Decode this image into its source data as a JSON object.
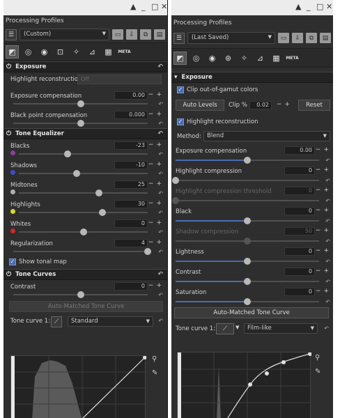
{
  "left": {
    "title_controls": {
      "up": "▲",
      "minimize": "_",
      "restore": "□",
      "close": "✕"
    },
    "profiles_title": "Processing Profiles",
    "profile_value": "(Custom)",
    "tab_meta_label": "META",
    "exposure": {
      "title": "Exposure",
      "highlight_label": "Highlight reconstruction:",
      "highlight_value": "Off",
      "comp_label": "Exposure compensation",
      "comp_value": "0.00",
      "comp_level": 0.5,
      "black_label": "Black point compensation",
      "black_value": "0.000",
      "black_level": 0.5
    },
    "tone_eq": {
      "title": "Tone Equalizer",
      "bands": [
        {
          "label": "Blacks",
          "value": "-23",
          "level": 0.38,
          "color": "#8a3ea0"
        },
        {
          "label": "Shadows",
          "value": "-10",
          "level": 0.45,
          "color": "#3b4fc4"
        },
        {
          "label": "Midtones",
          "value": "25",
          "level": 0.62,
          "color": "#b0b0b0"
        },
        {
          "label": "Highlights",
          "value": "30",
          "level": 0.65,
          "color": "#d8d82a"
        },
        {
          "label": "Whites",
          "value": "0",
          "level": 0.5,
          "color": "#d02828"
        }
      ],
      "reg_label": "Regularization",
      "reg_value": "4",
      "reg_level": 1.0,
      "show_map_label": "Show tonal map"
    },
    "tone_curves": {
      "title": "Tone Curves",
      "contrast_label": "Contrast",
      "contrast_value": "0",
      "contrast_level": 0.5,
      "auto_label": "Auto-Matched Tone Curve",
      "curve_label": "Tone curve 1:",
      "curve_type": "Standard"
    }
  },
  "right": {
    "title_controls": {
      "up": "▲",
      "minimize": "_",
      "restore": "□",
      "close": "✕"
    },
    "profiles_title": "Processing Profiles",
    "profile_value": "(Last Saved)",
    "tab_meta_label": "META",
    "exposure": {
      "title": "Exposure",
      "clip_label": "Clip out-of-gamut colors",
      "auto_levels_label": "Auto Levels",
      "clip_pct_label": "Clip %",
      "clip_pct_value": "0.02",
      "reset_label": "Reset",
      "highlight_label": "Highlight reconstruction",
      "method_label": "Method:",
      "method_value": "Blend",
      "sliders": [
        {
          "label": "Exposure compensation",
          "value": "0.00",
          "level": 0.5,
          "dim": false
        },
        {
          "label": "Highlight compression",
          "value": "0",
          "level": 0.0,
          "dim": false
        },
        {
          "label": "Highlight compression threshold",
          "value": "0",
          "level": 0.0,
          "dim": true
        },
        {
          "label": "Black",
          "value": "0",
          "level": 0.5,
          "dim": false
        },
        {
          "label": "Shadow compression",
          "value": "50",
          "level": 0.5,
          "dim": true
        },
        {
          "label": "Lightness",
          "value": "0",
          "level": 0.5,
          "dim": false
        },
        {
          "label": "Contrast",
          "value": "0",
          "level": 0.5,
          "dim": false
        },
        {
          "label": "Saturation",
          "value": "0",
          "level": 0.5,
          "dim": false
        }
      ],
      "auto_label": "Auto-Matched Tone Curve",
      "curve_label": "Tone curve 1:",
      "curve_type": "Film-like"
    }
  }
}
